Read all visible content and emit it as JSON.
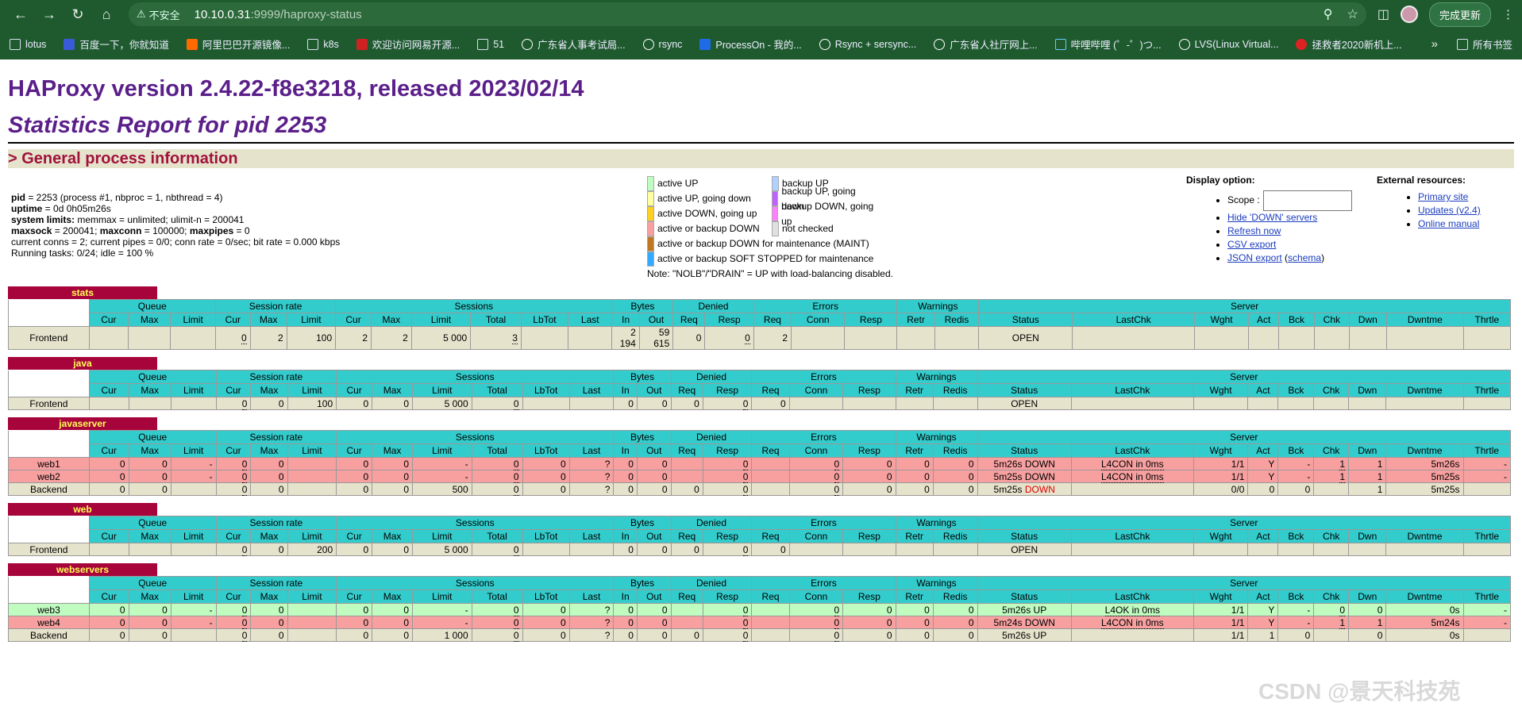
{
  "browser": {
    "secure_label": "不安全",
    "url_host": "10.10.0.31",
    "url_path": ":9999/haproxy-status",
    "update_label": "完成更新",
    "bookmarks": [
      "lotus",
      "百度一下，你就知道",
      "阿里巴巴开源镜像...",
      "k8s",
      "欢迎访问网易开源...",
      "51",
      "广东省人事考试局...",
      "rsync",
      "ProcessOn - 我的...",
      "Rsync + sersync...",
      "广东省人社厅网上...",
      "哔哩哔哩 (゜-゜)つ...",
      "LVS(Linux Virtual...",
      "拯救者2020新机上..."
    ],
    "bookmarks_more": "»",
    "all_bookmarks": "所有书签"
  },
  "title": "HAProxy version 2.4.22-f8e3218, released 2023/02/14",
  "subtitle": "Statistics Report for pid 2253",
  "section": "> General process information",
  "proc": {
    "l1a": "pid",
    "l1b": " = 2253 (process #1, nbproc = 1, nbthread = 4)",
    "l2a": "uptime",
    "l2b": " = 0d 0h05m26s",
    "l3a": "system limits:",
    "l3b": " memmax = unlimited; ulimit-n = 200041",
    "l4a": "maxsock",
    "l4b": " = 200041; ",
    "l4c": "maxconn",
    "l4d": " = 100000; ",
    "l4e": "maxpipes",
    "l4f": " = 0",
    "l5": "current conns = 2; current pipes = 0/0; conn rate = 0/sec; bit rate = 0.000 kbps",
    "l6": "Running tasks: 0/24; idle = 100 %"
  },
  "legend": {
    "col1": [
      {
        "label": "active UP",
        "color": "#c0fcc0"
      },
      {
        "label": "active UP, going down",
        "color": "#ffffa0"
      },
      {
        "label": "active DOWN, going up",
        "color": "#ffd020"
      },
      {
        "label": "active or backup DOWN",
        "color": "#f8a0a0"
      },
      {
        "label": "active or backup DOWN for maintenance (MAINT)",
        "color": "#c07820"
      },
      {
        "label": "active or backup SOFT STOPPED for maintenance",
        "color": "#33aaff"
      }
    ],
    "col2": [
      {
        "label": "backup UP",
        "color": "#b0d0ff"
      },
      {
        "label": "backup UP, going down",
        "color": "#c060ff"
      },
      {
        "label": "backup DOWN, going up",
        "color": "#ff80ff"
      },
      {
        "label": "not checked",
        "color": "#e0e0e0"
      }
    ],
    "note": "Note: \"NOLB\"/\"DRAIN\" = UP with load-balancing disabled."
  },
  "display": {
    "heading": "Display option:",
    "scope": "Scope :",
    "hide": "Hide 'DOWN' servers",
    "refresh": "Refresh now",
    "csv": "CSV export",
    "json": "JSON export",
    "schema": "schema"
  },
  "external": {
    "heading": "External resources:",
    "primary": "Primary site",
    "updates": "Updates (v2.4)",
    "manual": "Online manual"
  },
  "groups": [
    "Queue",
    "Session rate",
    "Sessions",
    "Bytes",
    "Denied",
    "Errors",
    "Warnings",
    "Server"
  ],
  "cols": [
    "Cur",
    "Max",
    "Limit",
    "Cur",
    "Max",
    "Limit",
    "Cur",
    "Max",
    "Limit",
    "Total",
    "LbTot",
    "Last",
    "In",
    "Out",
    "Req",
    "Resp",
    "Req",
    "Conn",
    "Resp",
    "Retr",
    "Redis",
    "Status",
    "LastChk",
    "Wght",
    "Act",
    "Bck",
    "Chk",
    "Dwn",
    "Dwntme",
    "Thrtle"
  ],
  "proxies": [
    {
      "name": "stats",
      "rows": [
        {
          "cls": "fe",
          "cells": [
            "Frontend",
            "",
            "",
            "",
            "0",
            "2",
            "100",
            "2",
            "2",
            "5 000",
            "3",
            "",
            "",
            "2 194",
            "59 615",
            "0",
            "0",
            "2",
            "",
            "",
            "",
            "",
            "OPEN",
            "",
            "",
            "",
            "",
            "",
            "",
            "",
            ""
          ]
        }
      ]
    },
    {
      "name": "java",
      "rows": [
        {
          "cls": "fe",
          "cells": [
            "Frontend",
            "",
            "",
            "",
            "0",
            "0",
            "100",
            "0",
            "0",
            "5 000",
            "0",
            "",
            "",
            "0",
            "0",
            "0",
            "0",
            "0",
            "",
            "",
            "",
            "",
            "OPEN",
            "",
            "",
            "",
            "",
            "",
            "",
            "",
            ""
          ]
        }
      ]
    },
    {
      "name": "javaserver",
      "rows": [
        {
          "cls": "dn",
          "cells": [
            "web1",
            "0",
            "0",
            "-",
            "0",
            "0",
            "",
            "0",
            "0",
            "-",
            "0",
            "0",
            "?",
            "0",
            "0",
            "",
            "0",
            "",
            "0",
            "0",
            "0",
            "0",
            "5m26s DOWN",
            "L4CON in 0ms",
            "1/1",
            "Y",
            "-",
            "1",
            "1",
            "5m26s",
            "-"
          ]
        },
        {
          "cls": "dn",
          "cells": [
            "web2",
            "0",
            "0",
            "-",
            "0",
            "0",
            "",
            "0",
            "0",
            "-",
            "0",
            "0",
            "?",
            "0",
            "0",
            "",
            "0",
            "",
            "0",
            "0",
            "0",
            "0",
            "5m25s DOWN",
            "L4CON in 0ms",
            "1/1",
            "Y",
            "-",
            "1",
            "1",
            "5m25s",
            "-"
          ]
        },
        {
          "cls": "be",
          "cells": [
            "Backend",
            "0",
            "0",
            "",
            "0",
            "0",
            "",
            "0",
            "0",
            "500",
            "0",
            "0",
            "?",
            "0",
            "0",
            "0",
            "0",
            "",
            "0",
            "0",
            "0",
            "0",
            "5m25s DOWN",
            "",
            "0/0",
            "0",
            "0",
            "",
            "1",
            "5m25s",
            ""
          ]
        }
      ]
    },
    {
      "name": "web",
      "rows": [
        {
          "cls": "fe",
          "cells": [
            "Frontend",
            "",
            "",
            "",
            "0",
            "0",
            "200",
            "0",
            "0",
            "5 000",
            "0",
            "",
            "",
            "0",
            "0",
            "0",
            "0",
            "0",
            "",
            "",
            "",
            "",
            "OPEN",
            "",
            "",
            "",
            "",
            "",
            "",
            "",
            ""
          ]
        }
      ]
    },
    {
      "name": "webservers",
      "rows": [
        {
          "cls": "up",
          "cells": [
            "web3",
            "0",
            "0",
            "-",
            "0",
            "0",
            "",
            "0",
            "0",
            "-",
            "0",
            "0",
            "?",
            "0",
            "0",
            "",
            "0",
            "",
            "0",
            "0",
            "0",
            "0",
            "5m26s UP",
            "L4OK in 0ms",
            "1/1",
            "Y",
            "-",
            "0",
            "0",
            "0s",
            "-"
          ]
        },
        {
          "cls": "dn",
          "cells": [
            "web4",
            "0",
            "0",
            "-",
            "0",
            "0",
            "",
            "0",
            "0",
            "-",
            "0",
            "0",
            "?",
            "0",
            "0",
            "",
            "0",
            "",
            "0",
            "0",
            "0",
            "0",
            "5m24s DOWN",
            "L4CON in 0ms",
            "1/1",
            "Y",
            "-",
            "1",
            "1",
            "5m24s",
            "-"
          ]
        },
        {
          "cls": "be",
          "cells": [
            "Backend",
            "0",
            "0",
            "",
            "0",
            "0",
            "",
            "0",
            "0",
            "1 000",
            "0",
            "0",
            "?",
            "0",
            "0",
            "0",
            "0",
            "",
            "0",
            "0",
            "0",
            "0",
            "5m26s UP",
            "",
            "1/1",
            "1",
            "0",
            "",
            "0",
            "0s",
            ""
          ]
        }
      ]
    }
  ],
  "watermark": "CSDN @景天科技苑"
}
